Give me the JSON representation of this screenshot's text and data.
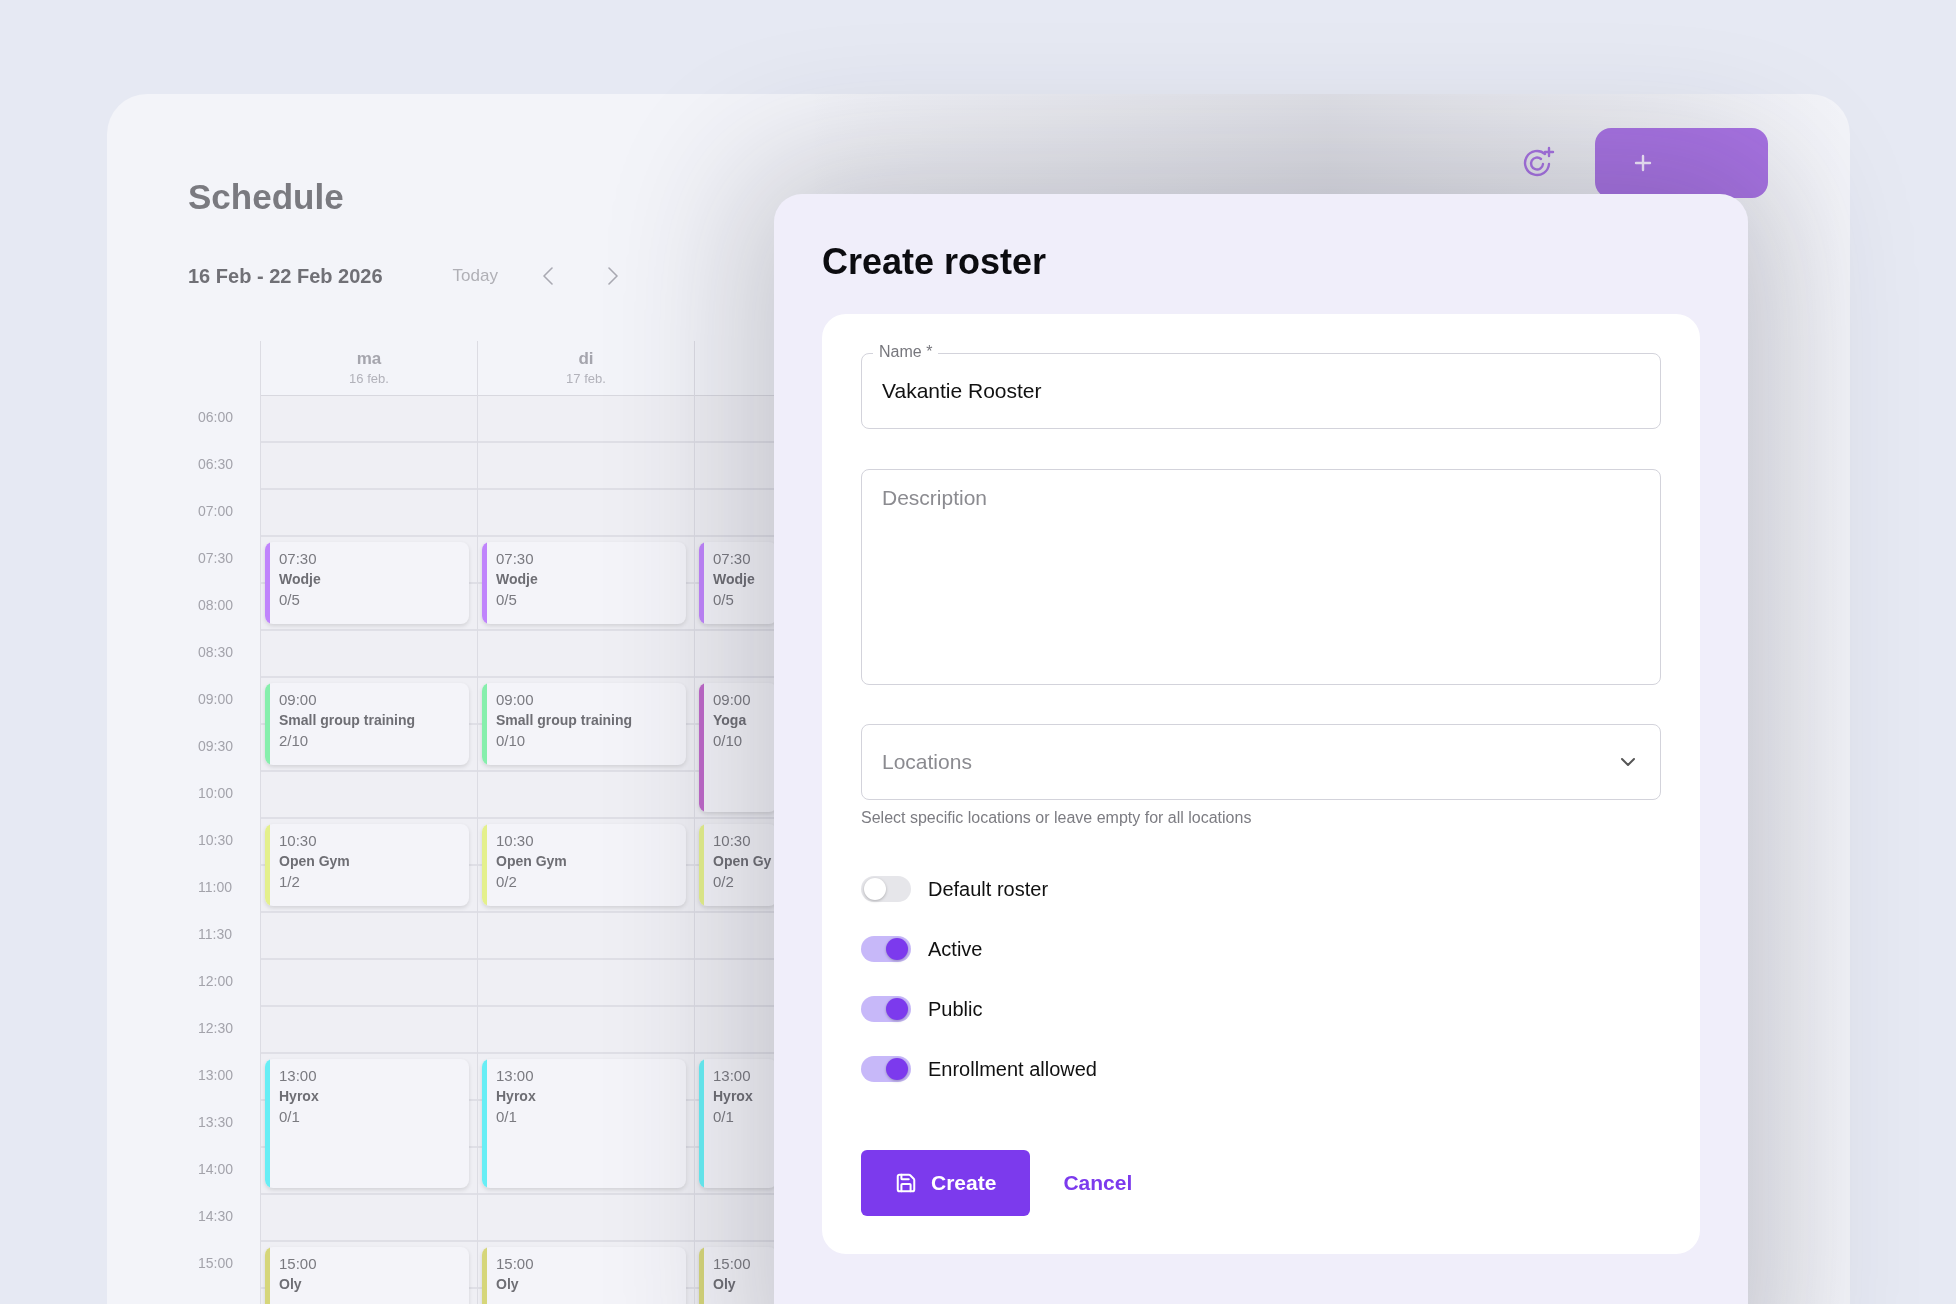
{
  "header": {
    "title": "Schedule"
  },
  "toolbar": {
    "date_range": "16 Feb - 22 Feb 2026",
    "today": "Today"
  },
  "calendar": {
    "time_labels": [
      "06:00",
      "06:30",
      "07:00",
      "07:30",
      "08:00",
      "08:30",
      "09:00",
      "09:30",
      "10:00",
      "10:30",
      "11:00",
      "11:30",
      "12:00",
      "12:30",
      "13:00",
      "13:30",
      "14:00",
      "14:30",
      "15:00"
    ],
    "days": [
      {
        "name": "ma",
        "date": "16 feb.",
        "events": [
          {
            "time": "07:30",
            "title": "Wodje",
            "count": "0/5",
            "kind": "short",
            "color": "#c084fc"
          },
          {
            "time": "09:00",
            "title": "Small group training",
            "count": "2/10",
            "kind": "short",
            "color": "#86efac"
          },
          {
            "time": "10:30",
            "title": "Open Gym",
            "count": "1/2",
            "kind": "short",
            "color": "#e4f08c"
          },
          {
            "time": "13:00",
            "title": "Hyrox",
            "count": "0/1",
            "kind": "long",
            "color": "#67eef5"
          },
          {
            "time": "15:00",
            "title": "Oly",
            "kind": "open",
            "color": "#d6d67a"
          }
        ]
      },
      {
        "name": "di",
        "date": "17 feb.",
        "events": [
          {
            "time": "07:30",
            "title": "Wodje",
            "count": "0/5",
            "kind": "short",
            "color": "#c084fc"
          },
          {
            "time": "09:00",
            "title": "Small group training",
            "count": "0/10",
            "kind": "short",
            "color": "#86efac"
          },
          {
            "time": "10:30",
            "title": "Open Gym",
            "count": "0/2",
            "kind": "short",
            "color": "#e4f08c"
          },
          {
            "time": "13:00",
            "title": "Hyrox",
            "count": "0/1",
            "kind": "long",
            "color": "#67eef5"
          },
          {
            "time": "15:00",
            "title": "Oly",
            "kind": "open",
            "color": "#d6d67a"
          }
        ]
      },
      {
        "events": [
          {
            "time": "07:30",
            "title": "Wodje",
            "count": "0/5",
            "kind": "short",
            "color": "#c084fc"
          },
          {
            "time": "09:00",
            "title": "Yoga",
            "count": "0/10",
            "kind": "long",
            "color": "#bf69c9"
          },
          {
            "time": "10:30",
            "title": "Open Gy",
            "count": "0/2",
            "kind": "short",
            "color": "#e4f08c"
          },
          {
            "time": "13:00",
            "title": "Hyrox",
            "count": "0/1",
            "kind": "long",
            "color": "#67eef5"
          },
          {
            "time": "15:00",
            "title": "Oly",
            "kind": "open",
            "color": "#d6d67a"
          }
        ]
      }
    ]
  },
  "dialog": {
    "title": "Create roster",
    "name_field": {
      "label": "Name *",
      "value": "Vakantie Rooster"
    },
    "description_field": {
      "placeholder": "Description"
    },
    "locations_field": {
      "placeholder": "Locations",
      "hint": "Select specific locations or leave empty for all locations"
    },
    "switches": [
      {
        "label": "Default roster",
        "on": false
      },
      {
        "label": "Active",
        "on": true
      },
      {
        "label": "Public",
        "on": true
      },
      {
        "label": "Enrollment allowed",
        "on": true
      }
    ],
    "buttons": {
      "create": "Create",
      "cancel": "Cancel"
    }
  }
}
